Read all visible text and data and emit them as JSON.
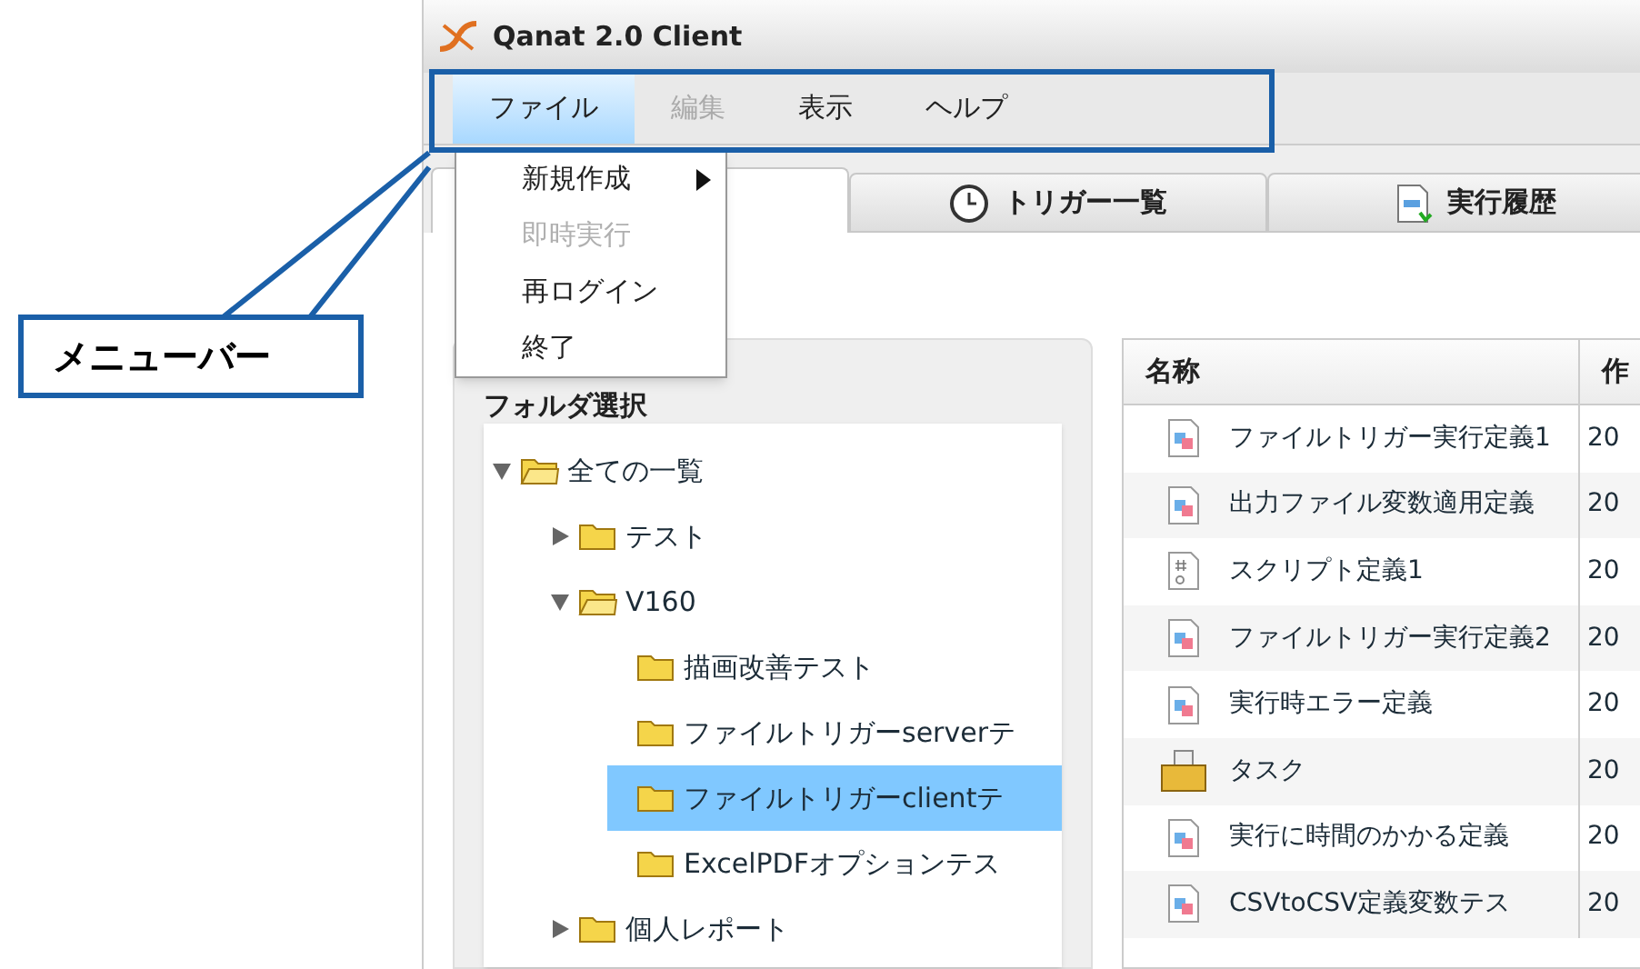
{
  "window": {
    "title": "Qanat 2.0 Client"
  },
  "menu_bar": [
    {
      "label": "ファイル",
      "selected": true,
      "disabled": false
    },
    {
      "label": "編集",
      "selected": false,
      "disabled": true
    },
    {
      "label": "表示",
      "selected": false,
      "disabled": false
    },
    {
      "label": "ヘルプ",
      "selected": false,
      "disabled": false
    }
  ],
  "file_menu": [
    {
      "label": "新規作成",
      "disabled": false,
      "submenu": true
    },
    {
      "label": "即時実行",
      "disabled": true,
      "submenu": false
    },
    {
      "label": "再ログイン",
      "disabled": false,
      "submenu": false
    },
    {
      "label": "終了",
      "disabled": false,
      "submenu": false
    }
  ],
  "tabs": [
    {
      "selected": true
    },
    {
      "label": "トリガー一覧",
      "selected": false
    },
    {
      "label": "実行履歴",
      "selected": false
    }
  ],
  "folder_panel": {
    "title": "フォルダ選択",
    "tree": [
      {
        "label": "全ての一覧",
        "expanded": true,
        "selected": false,
        "children": [
          {
            "label": "テスト",
            "expanded": false,
            "selected": false
          },
          {
            "label": "V160",
            "expanded": true,
            "selected": false,
            "children": [
              {
                "label": "描画改善テスト",
                "selected": false
              },
              {
                "label": "ファイルトリガーserverテ",
                "selected": false
              },
              {
                "label": "ファイルトリガーclientテ",
                "selected": true
              },
              {
                "label": "ExcelPDFオプションテス",
                "selected": false
              }
            ]
          },
          {
            "label": "個人レポート",
            "expanded": false,
            "selected": false
          }
        ]
      }
    ]
  },
  "table": {
    "columns": [
      "名称",
      "作"
    ],
    "rows": [
      {
        "kind": "definition",
        "name": "ファイルトリガー実行定義1",
        "column_2": "20"
      },
      {
        "kind": "definition",
        "name": "出力ファイル変数適用定義",
        "column_2": "20"
      },
      {
        "kind": "script",
        "name": "スクリプト定義1",
        "column_2": "20"
      },
      {
        "kind": "definition",
        "name": "ファイルトリガー実行定義2",
        "column_2": "20"
      },
      {
        "kind": "definition",
        "name": "実行時エラー定義",
        "column_2": "20"
      },
      {
        "kind": "task",
        "name": "タスク",
        "column_2": "20"
      },
      {
        "kind": "definition",
        "name": "実行に時間のかかる定義",
        "column_2": "20"
      },
      {
        "kind": "definition",
        "name": "CSVtoCSV定義変数テス",
        "column_2": "20"
      }
    ]
  },
  "callout": {
    "label": "メニューバー"
  }
}
